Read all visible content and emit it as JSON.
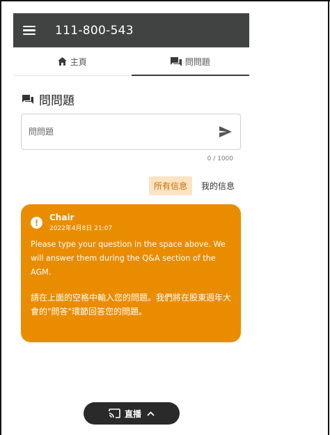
{
  "header": {
    "meeting_id": "111-800-543"
  },
  "tabs": [
    {
      "label": "主頁",
      "icon": "home-icon",
      "active": false
    },
    {
      "label": "問問題",
      "icon": "chat-icon",
      "active": true
    }
  ],
  "section": {
    "title": "問問題",
    "icon": "chat-icon"
  },
  "question": {
    "placeholder": "問問題",
    "value": "",
    "counter": "0 / 1000"
  },
  "filters": {
    "all": "所有信息",
    "mine": "我的信息",
    "selected": "all"
  },
  "message": {
    "sender": "Chair",
    "timestamp": "2022年4月8日 21:07",
    "text_en": "Please type your question in the space above. We will answer them during the Q&A section of the AGM.",
    "text_zh": "請在上面的空格中輸入您的問題。我們將在股東週年大會的\"問答\"環節回答您的問題。"
  },
  "live": {
    "label": "直播"
  },
  "colors": {
    "topbar": "#414242",
    "accent": "#ea8c00",
    "filter_active_bg": "#fbe3c4"
  }
}
